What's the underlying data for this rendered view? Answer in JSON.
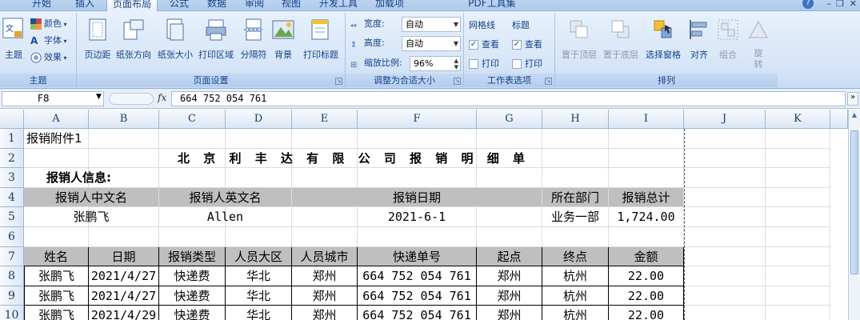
{
  "ribbon": {
    "tabs": [
      "开始",
      "插入",
      "页面布局",
      "公式",
      "数据",
      "审阅",
      "视图",
      "开发工具",
      "加载项",
      "PDF工具集"
    ],
    "active_tab": "页面布局",
    "groups": {
      "theme": {
        "label": "主题",
        "big_label": "主题",
        "colors": "颜色",
        "fonts": "字体",
        "effects": "效果"
      },
      "page_setup": {
        "label": "页面设置",
        "buttons": [
          "页边距",
          "纸张方向",
          "纸张大小",
          "打印区域",
          "分隔符",
          "背景",
          "打印标题"
        ]
      },
      "scale": {
        "label": "调整为合适大小",
        "width_label": "宽度:",
        "width_value": "自动",
        "height_label": "高度:",
        "height_value": "自动",
        "ratio_label": "缩放比例:",
        "ratio_value": "96%"
      },
      "sheet_options": {
        "label": "工作表选项",
        "gridlines": "网格线",
        "headings": "标题",
        "view": "查看",
        "print": "打印"
      },
      "arrange": {
        "label": "排列",
        "buttons": [
          "置于顶层",
          "置于底层",
          "选择窗格",
          "对齐",
          "组合",
          "旋转"
        ]
      }
    }
  },
  "formula_bar": {
    "name_box": "F8",
    "fx": "fx",
    "content": "664 752 054 761"
  },
  "sheet": {
    "columns": [
      "A",
      "B",
      "C",
      "D",
      "E",
      "F",
      "G",
      "H",
      "I",
      "J",
      "K"
    ],
    "rows": [
      "1",
      "2",
      "3",
      "4",
      "5",
      "6",
      "7",
      "8",
      "9",
      "10"
    ],
    "r1": "报销附件1",
    "r2": "北 京 利 丰 达 有 限 公 司 报 销 明 细 单",
    "r3": "报销人信息:",
    "r4": [
      "报销人中文名",
      "报销人英文名",
      "报销日期",
      "所在部门",
      "报销总计"
    ],
    "r5": [
      "张鹏飞",
      "Allen",
      "2021-6-1",
      "业务一部",
      "1,724.00"
    ],
    "r7": [
      "姓名",
      "日期",
      "报销类型",
      "人员大区",
      "人员城市",
      "快递单号",
      "起点",
      "终点",
      "金额"
    ],
    "data_rows": [
      [
        "张鹏飞",
        "2021/4/27",
        "快递费",
        "华北",
        "郑州",
        "664 752 054 761",
        "郑州",
        "杭州",
        "22.00"
      ],
      [
        "张鹏飞",
        "2021/4/27",
        "快递费",
        "华北",
        "郑州",
        "664 752 054 761",
        "郑州",
        "杭州",
        "22.00"
      ],
      [
        "张鹏飞",
        "2021/4/29",
        "快递费",
        "华北",
        "郑州",
        "664 752 054 761",
        "郑州",
        "杭州",
        "22.00"
      ]
    ]
  }
}
